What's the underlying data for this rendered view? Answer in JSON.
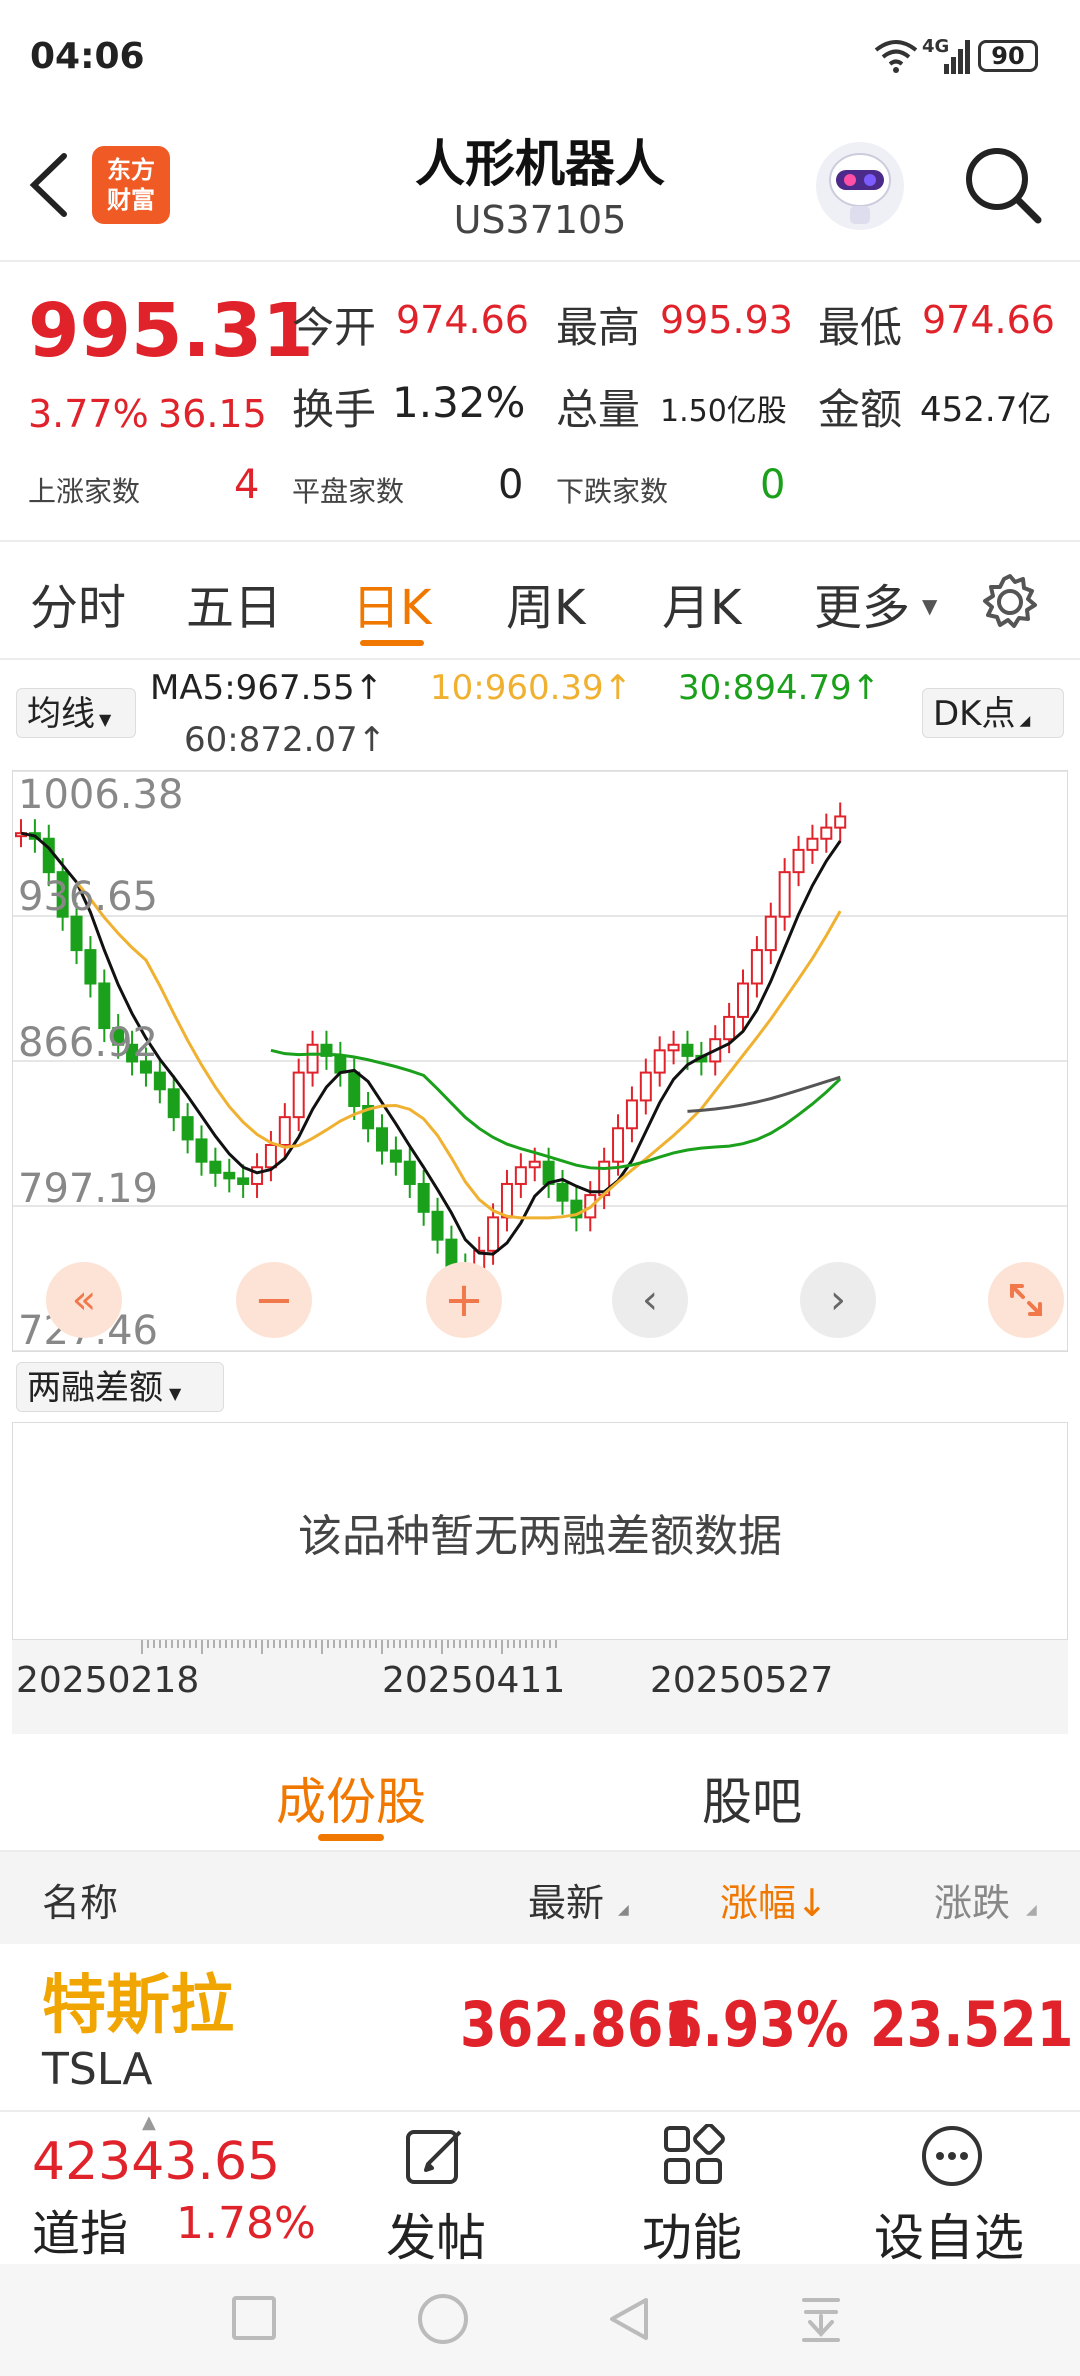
{
  "status_bar": {
    "time": "04:06",
    "network": "4G",
    "battery": "90"
  },
  "header": {
    "logo_line1": "东方",
    "logo_line2": "财富",
    "title": "人形机器人",
    "code": "US37105"
  },
  "quote": {
    "price": "995.31",
    "change_pct": "3.77%",
    "change": "36.15",
    "open_label": "今开",
    "open": "974.66",
    "high_label": "最高",
    "high": "995.93",
    "low_label": "最低",
    "low": "974.66",
    "turnover_label": "换手",
    "turnover": "1.32%",
    "volume_label": "总量",
    "volume": "1.50亿股",
    "amount_label": "金额",
    "amount": "452.7亿",
    "up_label": "上涨家数",
    "up": "4",
    "flat_label": "平盘家数",
    "flat": "0",
    "down_label": "下跌家数",
    "down": "0"
  },
  "tabs": [
    "分时",
    "五日",
    "日K",
    "周K",
    "月K",
    "更多"
  ],
  "active_tab": "日K",
  "ma": {
    "selector": "均线",
    "ma5": "MA5:967.55↑",
    "ma10": "10:960.39↑",
    "ma30": "30:894.79↑",
    "ma60": "60:872.07↑",
    "dk": "DK点"
  },
  "colors": {
    "up": "#e0232b",
    "down": "#1aa01a",
    "ma5": "#111111",
    "ma10": "#f0b030",
    "ma30": "#1aa01a",
    "ma60": "#555555",
    "accent": "#f07800"
  },
  "chart_data": {
    "type": "candlestick",
    "y_ticks": [
      "1006.38",
      "936.65",
      "866.92",
      "797.19",
      "727.46"
    ],
    "ylim": [
      727.46,
      1006.38
    ],
    "x_ticks": [
      "20250218",
      "20250411",
      "20250527"
    ]
  },
  "sub_chart": {
    "selector": "两融差额",
    "empty_text": "该品种暂无两融差额数据"
  },
  "section_tabs": [
    "成份股",
    "股吧"
  ],
  "table": {
    "headers": [
      "名称",
      "最新",
      "涨幅↓",
      "涨跌"
    ],
    "rows": [
      {
        "name": "特斯拉",
        "code": "TSLA",
        "price": "362.861",
        "pct": "6.93%",
        "change": "23.521"
      }
    ]
  },
  "bottom": {
    "index_value": "42343.65",
    "index_name": "道指",
    "index_pct": "1.78%",
    "post": "发帖",
    "func": "功能",
    "watch": "设自选"
  }
}
